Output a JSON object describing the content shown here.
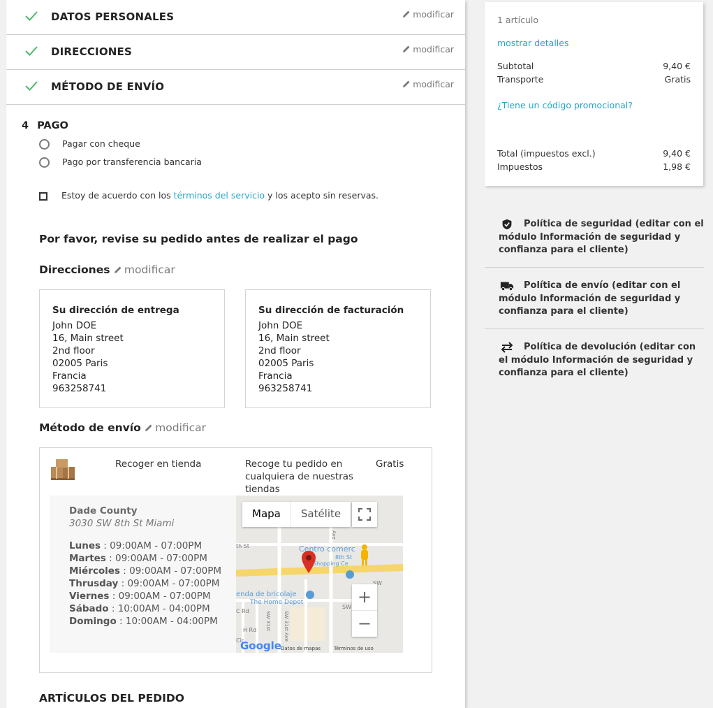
{
  "steps": [
    {
      "title": "DATOS PERSONALES",
      "modify": "modificar"
    },
    {
      "title": "DIRECCIONES",
      "modify": "modificar"
    },
    {
      "title": "MÉTODO DE ENVÍO",
      "modify": "modificar"
    }
  ],
  "payment": {
    "number": "4",
    "title": "PAGO",
    "options": [
      "Pagar con cheque",
      "Pago por transferencia bancaria"
    ],
    "terms_pre": "Estoy de acuerdo con los ",
    "terms_link": "términos del servicio",
    "terms_post": " y los acepto sin reservas."
  },
  "review": {
    "heading": "Por favor, revise su pedido antes de realizar el pago",
    "addresses_title": "Direcciones",
    "addresses_modify": "modificar",
    "delivery": {
      "title": "Su dirección de entrega",
      "lines": [
        "John DOE",
        "16, Main street",
        "2nd floor",
        "02005 Paris",
        "Francia",
        "963258741"
      ]
    },
    "invoice": {
      "title": "Su dirección de facturación",
      "lines": [
        "John DOE",
        "16, Main street",
        "2nd floor",
        "02005 Paris",
        "Francia",
        "963258741"
      ]
    },
    "shipping_title": "Método de envío",
    "shipping_modify": "modificar",
    "carrier": {
      "name": "Recoger en tienda",
      "description": "Recoge tu pedido en cualquiera de nuestras tiendas",
      "price": "Gratis"
    },
    "store": {
      "name": "Dade County",
      "address": "3030 SW 8th St Miami",
      "hours": [
        {
          "day": "Lunes",
          "time": "09:00AM - 07:00PM"
        },
        {
          "day": "Martes",
          "time": "09:00AM - 07:00PM"
        },
        {
          "day": "Miércoles",
          "time": "09:00AM - 07:00PM"
        },
        {
          "day": "Thrusday",
          "time": "09:00AM - 07:00PM"
        },
        {
          "day": "Viernes",
          "time": "09:00AM - 07:00PM"
        },
        {
          "day": "Sábado",
          "time": "10:00AM - 04:00PM"
        },
        {
          "day": "Domingo",
          "time": "10:00AM - 04:00PM"
        }
      ]
    },
    "map": {
      "tab_map": "Mapa",
      "tab_satellite": "Satélite",
      "zoom_in": "+",
      "zoom_out": "−",
      "labels": {
        "centro": "Centro comerc",
        "eighth": "8th St",
        "shopping": "Shopping Ce",
        "bricolaje": "enda de bricolaje",
        "home_depot": "The Home Depot",
        "sw": "SW",
        "sw31st": "SW 31st",
        "sw31stave": "SW 31st Ave",
        "thst": "th St",
        "ave": "Ave",
        "crd": "C Rd",
        "hrd": "H Rd",
        "cir": "Cir"
      },
      "google": "Google",
      "data_label": "Datos de mapas",
      "terms_label": "Términos de uso"
    },
    "articles_title": "ARTÍCULOS DEL PEDIDO"
  },
  "cart": {
    "count": "1 artículo",
    "show_details": "mostrar detalles",
    "subtotal_label": "Subtotal",
    "subtotal_value": "9,40 €",
    "shipping_label": "Transporte",
    "shipping_value": "Gratis",
    "promo": "¿Tiene un código promocional?",
    "total_label": "Total (impuestos excl.)",
    "total_value": "9,40 €",
    "taxes_label": "Impuestos",
    "taxes_value": "1,98 €"
  },
  "reassurance": [
    {
      "icon": "shield-icon",
      "text": "Política de seguridad (editar con el módulo Información de seguridad y confianza para el cliente)"
    },
    {
      "icon": "truck-icon",
      "text": "Política de envío (editar con el módulo Información de seguridad y confianza para el cliente)"
    },
    {
      "icon": "swap-arrows-icon",
      "text": "Política de devolución (editar con el módulo Información de seguridad y confianza para el cliente)"
    }
  ],
  "colors": {
    "accent": "#25a6c8",
    "check": "#4cbb6c",
    "pin": "#d93025"
  }
}
